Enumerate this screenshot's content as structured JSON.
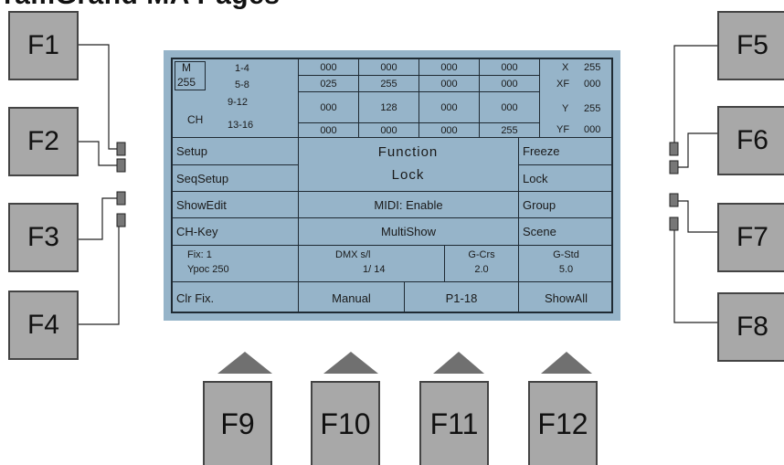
{
  "heading": "ramGrand MA Pages",
  "fkeys": {
    "f1": "F1",
    "f2": "F2",
    "f3": "F3",
    "f4": "F4",
    "f5": "F5",
    "f6": "F6",
    "f7": "F7",
    "f8": "F8",
    "f9": "F9",
    "f10": "F10",
    "f11": "F11",
    "f12": "F12"
  },
  "lcd": {
    "status": {
      "m_label": "M",
      "m_value": "255",
      "ch_label": "CH",
      "ranges": [
        "1-4",
        "5-8",
        "9-12",
        "13-16"
      ]
    },
    "grid": [
      [
        "000",
        "000",
        "000",
        "000"
      ],
      [
        "025",
        "255",
        "000",
        "000"
      ],
      [
        "000",
        "128",
        "000",
        "000"
      ],
      [
        "000",
        "000",
        "000",
        "255"
      ]
    ],
    "xy": [
      {
        "label": "X",
        "value": "255"
      },
      {
        "label": "XF",
        "value": "000"
      },
      {
        "label": "Y",
        "value": "255"
      },
      {
        "label": "YF",
        "value": "000"
      }
    ],
    "menu_left": [
      "Setup",
      "SeqSetup",
      "ShowEdit",
      "CH-Key"
    ],
    "menu_right": [
      "Freeze",
      "Lock",
      "Group",
      "Scene"
    ],
    "center": {
      "line1": "Function",
      "line2": "Lock",
      "midi": "MIDI: Enable",
      "multishow": "MultiShow"
    },
    "info": {
      "fix": "Fix: 1",
      "ypoc": "Ypoc  250",
      "dmx_label": "DMX s/l",
      "dmx_value": "1/ 14",
      "gcrs_label": "G-Crs",
      "gcrs_value": "2.0",
      "gstd_label": "G-Std",
      "gstd_value": "5.0"
    },
    "bottom": [
      "Clr Fix.",
      "Manual",
      "P1-18",
      "ShowAll"
    ]
  },
  "colors": {
    "lcd_bg": "#96b4c9",
    "key_bg": "#a8a8a8",
    "arrow": "#707070"
  }
}
